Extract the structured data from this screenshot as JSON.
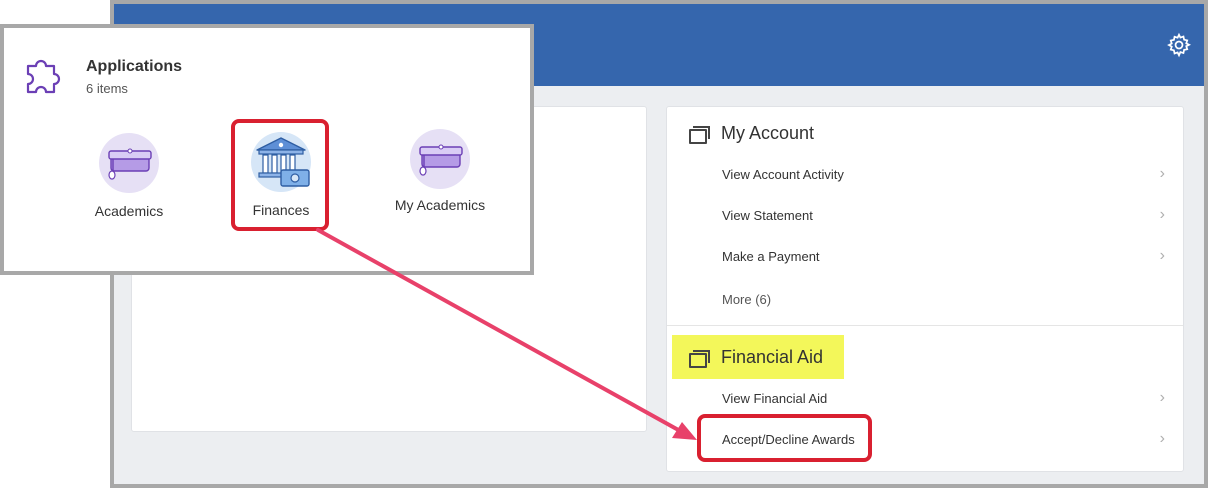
{
  "my_account": {
    "title": "My Account",
    "items": [
      {
        "label": "View Account Activity"
      },
      {
        "label": "View Statement"
      },
      {
        "label": "Make a Payment"
      }
    ],
    "more_label": "More (6)"
  },
  "financial_aid": {
    "title": "Financial Aid",
    "items": [
      {
        "label": "View Financial Aid"
      },
      {
        "label": "Accept/Decline Awards"
      }
    ]
  },
  "applications": {
    "title": "Applications",
    "subtitle": "6 items",
    "tiles": [
      {
        "label": "Academics",
        "icon": "graduation-cap-icon"
      },
      {
        "label": "Finances",
        "icon": "bank-money-icon"
      },
      {
        "label": "My Academics",
        "icon": "graduation-cap-icon"
      }
    ]
  },
  "colors": {
    "header_blue": "#3566ad",
    "highlight_yellow": "#f3f75a",
    "callout_red": "#d92030",
    "arrow_pink": "#e8416a"
  }
}
